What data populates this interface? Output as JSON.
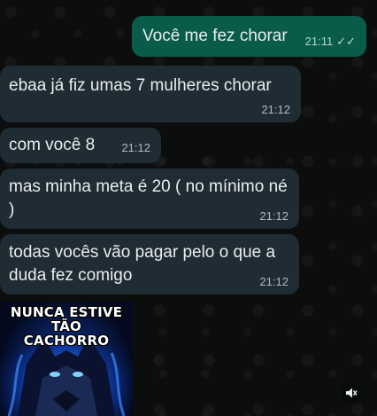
{
  "messages": [
    {
      "text": "Você me fez chorar",
      "time": "21:11",
      "direction": "outgoing",
      "status": "read"
    },
    {
      "text": "ebaa já fiz umas 7 mulheres chorar",
      "time": "21:12",
      "direction": "incoming"
    },
    {
      "text": "com você 8",
      "time": "21:12",
      "direction": "incoming"
    },
    {
      "text": "mas minha meta é 20 ( no mínimo né )",
      "time": "21:12",
      "direction": "incoming"
    },
    {
      "text": "todas vocês vão pagar pelo o que a duda fez comigo",
      "time": "21:12",
      "direction": "incoming"
    }
  ],
  "sticker": {
    "caption_line1": "NUNCA ESTIVE TÃO",
    "caption_line2": "CACHORRO",
    "icon": "wolf-icon"
  },
  "controls": {
    "mute_icon": "mute-icon"
  },
  "colors": {
    "incoming_bubble": "#1f2c33",
    "outgoing_bubble": "#0a5c4a",
    "background": "#0c0e0d",
    "read_ticks": "#c9d7d2"
  }
}
